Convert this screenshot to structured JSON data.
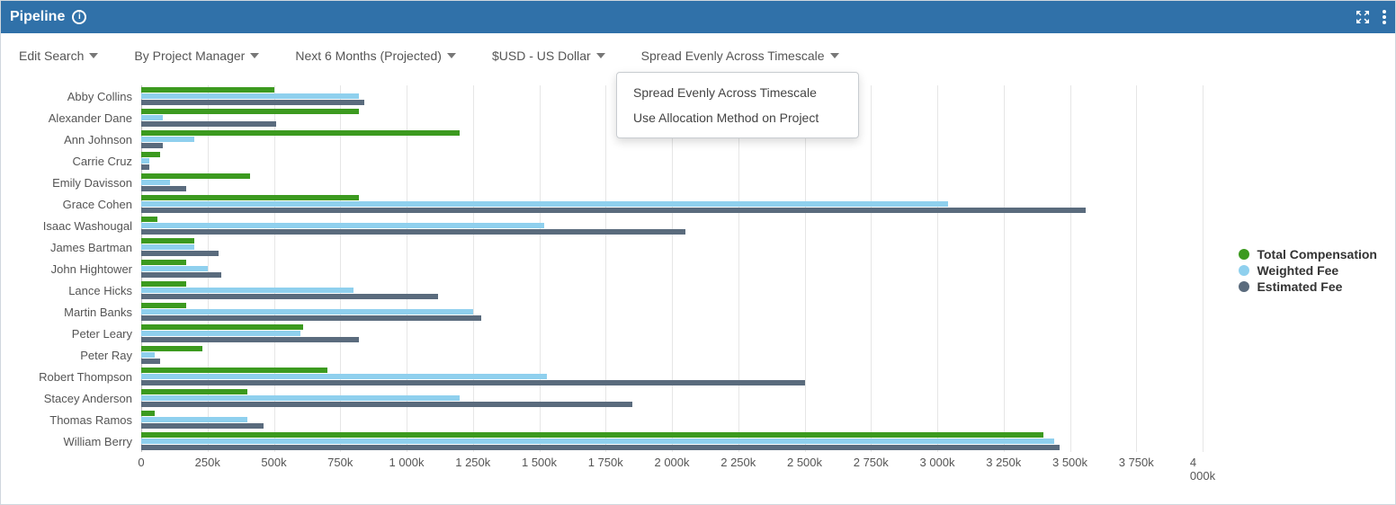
{
  "header": {
    "title": "Pipeline",
    "info_label": "i"
  },
  "toolbar": {
    "edit_search": "Edit Search",
    "group_by": "By Project Manager",
    "time_range": "Next 6 Months (Projected)",
    "currency": "$USD - US Dollar",
    "allocation": "Spread Evenly Across Timescale"
  },
  "dropdown": {
    "items": [
      "Spread Evenly Across Timescale",
      "Use Allocation Method on Project"
    ]
  },
  "legend": {
    "total": "Total Compensation",
    "weighted": "Weighted Fee",
    "estimated": "Estimated Fee"
  },
  "colors": {
    "header_bg": "#3071a9",
    "total": "#3c9a1f",
    "weighted": "#8fd0ee",
    "estimated": "#5a6b7d"
  },
  "chart_data": {
    "type": "bar",
    "orientation": "horizontal",
    "xlabel": "",
    "ylabel": "",
    "xlim": [
      0,
      4000000
    ],
    "x_ticks": [
      0,
      250000,
      500000,
      750000,
      1000000,
      1250000,
      1500000,
      1750000,
      2000000,
      2250000,
      2500000,
      2750000,
      3000000,
      3250000,
      3500000,
      3750000,
      4000000
    ],
    "x_tick_labels": [
      "0",
      "250k",
      "500k",
      "750k",
      "1 000k",
      "1 250k",
      "1 500k",
      "1 750k",
      "2 000k",
      "2 250k",
      "2 500k",
      "2 750k",
      "3 000k",
      "3 250k",
      "3 500k",
      "3 750k",
      "4 000k"
    ],
    "categories": [
      "Abby Collins",
      "Alexander Dane",
      "Ann Johnson",
      "Carrie Cruz",
      "Emily Davisson",
      "Grace Cohen",
      "Isaac Washougal",
      "James Bartman",
      "John Hightower",
      "Lance Hicks",
      "Martin Banks",
      "Peter Leary",
      "Peter Ray",
      "Robert Thompson",
      "Stacey Anderson",
      "Thomas Ramos",
      "William Berry"
    ],
    "series": [
      {
        "name": "Total Compensation",
        "color": "#3c9a1f",
        "values": [
          500000,
          820000,
          1200000,
          70000,
          410000,
          820000,
          60000,
          200000,
          170000,
          170000,
          170000,
          610000,
          230000,
          700000,
          400000,
          50000,
          3400000
        ]
      },
      {
        "name": "Weighted Fee",
        "color": "#8fd0ee",
        "values": [
          820000,
          80000,
          200000,
          30000,
          110000,
          3040000,
          1520000,
          200000,
          250000,
          800000,
          1250000,
          600000,
          50000,
          1530000,
          1200000,
          400000,
          3440000
        ]
      },
      {
        "name": "Estimated Fee",
        "color": "#5a6b7d",
        "values": [
          840000,
          510000,
          80000,
          30000,
          170000,
          3560000,
          2050000,
          290000,
          300000,
          1120000,
          1280000,
          820000,
          70000,
          2500000,
          1850000,
          460000,
          3460000
        ]
      }
    ]
  }
}
